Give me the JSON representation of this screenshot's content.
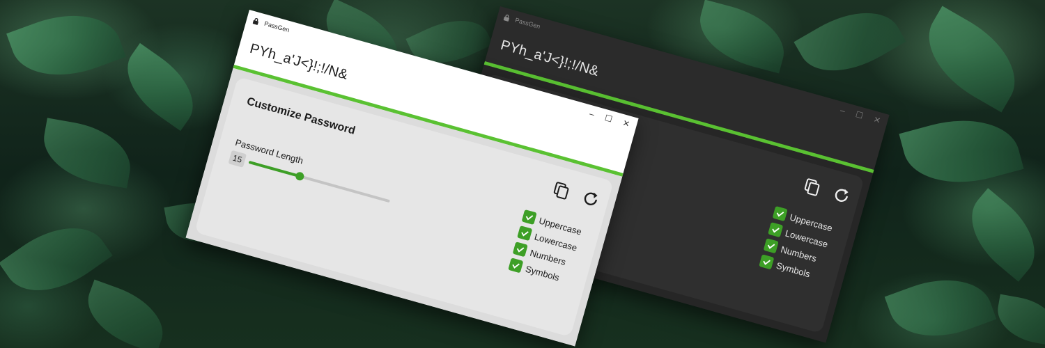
{
  "app": {
    "title": "PassGen"
  },
  "window_controls": {
    "minimize": "–",
    "maximize": "☐",
    "close": "✕"
  },
  "password": {
    "value": "PYh_a'J<}!;!/N&"
  },
  "customize": {
    "title": "Customize Password",
    "length_label": "Password Length",
    "length_value": "15",
    "length_slider_fraction": 0.36
  },
  "options": [
    {
      "label": "Uppercase",
      "checked": true
    },
    {
      "label": "Lowercase",
      "checked": true
    },
    {
      "label": "Numbers",
      "checked": true
    },
    {
      "label": "Symbols",
      "checked": true
    }
  ],
  "icons": {
    "app": "lock-icon",
    "copy": "copy-icon",
    "refresh": "refresh-icon",
    "check": "checkmark-icon"
  },
  "colors": {
    "accent": "#5ac132",
    "checkbox": "#3d9f26",
    "light_bg": "#dcdcdc",
    "dark_bg": "#262626"
  }
}
